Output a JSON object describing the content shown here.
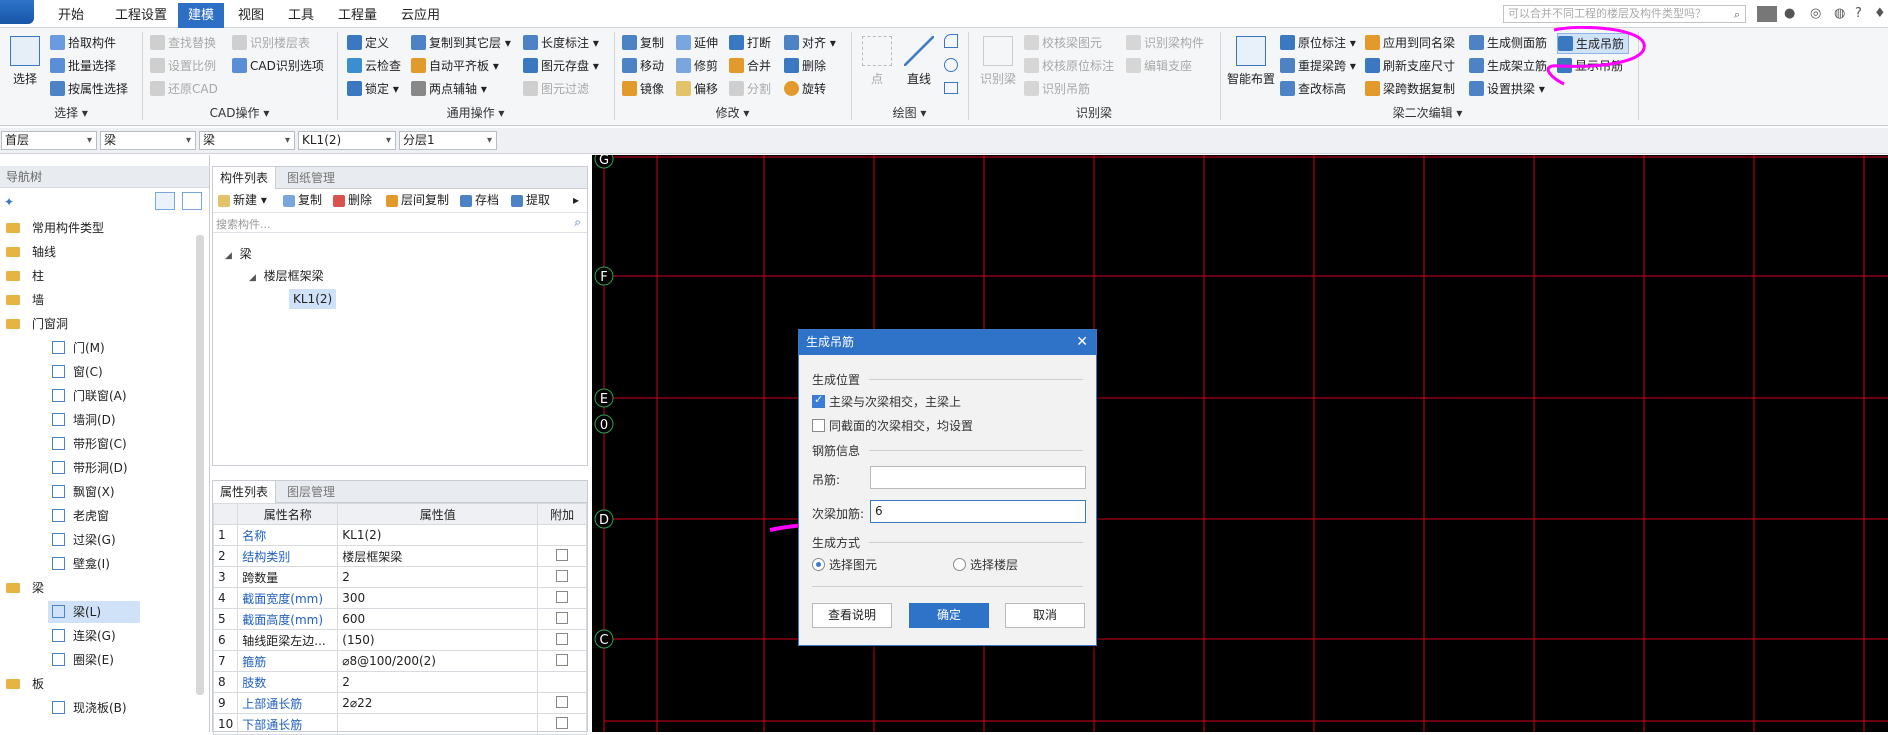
{
  "menubar": {
    "items": [
      "开始",
      "工程设置",
      "建模",
      "视图",
      "工具",
      "工程量",
      "云应用"
    ],
    "active_index": 2,
    "search_placeholder": "可以合并不同工程的楼层及构件类型吗？"
  },
  "ribbon": {
    "select_group": {
      "big_button": "选择",
      "buttons": [
        "拾取构件",
        "批量选择",
        "按属性选择"
      ],
      "label": "选择"
    },
    "cad_group": {
      "buttons": [
        "查找替换",
        "设置比例",
        "还原CAD",
        "识别楼层表",
        "CAD识别选项"
      ],
      "label": "CAD操作"
    },
    "general_group": {
      "buttons": [
        "定义",
        "云检查",
        "锁定",
        "复制到其它层",
        "自动平齐板",
        "两点辅轴",
        "长度标注",
        "图元存盘",
        "图元过滤"
      ],
      "label": "通用操作"
    },
    "modify_group": {
      "buttons": [
        "复制",
        "移动",
        "镜像",
        "延伸",
        "修剪",
        "偏移",
        "打断",
        "合并",
        "分割",
        "对齐",
        "删除",
        "旋转"
      ],
      "label": "修改"
    },
    "draw_group": {
      "buttons": [
        "点",
        "直线"
      ],
      "label": "绘图"
    },
    "recognize_group": {
      "buttons": [
        "识别梁",
        "校核梁图元",
        "校核原位标注",
        "识别吊筋",
        "识别梁构件",
        "编辑支座"
      ],
      "label": "识别梁"
    },
    "beam_edit_group": {
      "buttons": [
        "智能布置",
        "原位标注",
        "重提梁跨",
        "查改标高",
        "应用到同名梁",
        "刷新支座尺寸",
        "梁跨数据复制",
        "生成侧面筋",
        "生成架立筋",
        "设置拱梁",
        "生成吊筋",
        "显示吊筋"
      ],
      "label": "梁二次编辑"
    }
  },
  "selectors": [
    "首层",
    "梁",
    "梁",
    "KL1(2)",
    "分层1"
  ],
  "nav": {
    "title": "导航树",
    "items": [
      {
        "label": "常用构件类型",
        "type": "folder"
      },
      {
        "label": "轴线",
        "type": "folder"
      },
      {
        "label": "柱",
        "type": "folder"
      },
      {
        "label": "墙",
        "type": "folder"
      },
      {
        "label": "门窗洞",
        "type": "folder"
      },
      {
        "label": "门(M)",
        "type": "child"
      },
      {
        "label": "窗(C)",
        "type": "child"
      },
      {
        "label": "门联窗(A)",
        "type": "child"
      },
      {
        "label": "墙洞(D)",
        "type": "child"
      },
      {
        "label": "带形窗(C)",
        "type": "child"
      },
      {
        "label": "带形洞(D)",
        "type": "child"
      },
      {
        "label": "飘窗(X)",
        "type": "child"
      },
      {
        "label": "老虎窗",
        "type": "child"
      },
      {
        "label": "过梁(G)",
        "type": "child"
      },
      {
        "label": "壁龛(I)",
        "type": "child"
      },
      {
        "label": "梁",
        "type": "folder"
      },
      {
        "label": "梁(L)",
        "type": "child",
        "selected": true
      },
      {
        "label": "连梁(G)",
        "type": "child"
      },
      {
        "label": "圈梁(E)",
        "type": "child"
      },
      {
        "label": "板",
        "type": "folder"
      },
      {
        "label": "现浇板(B)",
        "type": "child"
      }
    ]
  },
  "component_list": {
    "tabs": [
      "构件列表",
      "图纸管理"
    ],
    "toolbar": [
      "新建",
      "复制",
      "删除",
      "层间复制",
      "存档",
      "提取"
    ],
    "search_placeholder": "搜索构件...",
    "tree": {
      "root": "梁",
      "group": "楼层框架梁",
      "item": "KL1(2)"
    }
  },
  "property_list": {
    "tabs": [
      "属性列表",
      "图层管理"
    ],
    "headers": [
      "属性名称",
      "属性值",
      "附加"
    ],
    "rows": [
      {
        "n": "1",
        "name": "名称",
        "value": "KL1(2)",
        "blue": true,
        "check": false
      },
      {
        "n": "2",
        "name": "结构类别",
        "value": "楼层框架梁",
        "blue": true,
        "check": true
      },
      {
        "n": "3",
        "name": "跨数量",
        "value": "2",
        "blue": false,
        "check": true
      },
      {
        "n": "4",
        "name": "截面宽度(mm)",
        "value": "300",
        "blue": true,
        "check": true
      },
      {
        "n": "5",
        "name": "截面高度(mm)",
        "value": "600",
        "blue": true,
        "check": true
      },
      {
        "n": "6",
        "name": "轴线距梁左边...",
        "value": "(150)",
        "blue": false,
        "check": true
      },
      {
        "n": "7",
        "name": "箍筋",
        "value": "⌀8@100/200(2)",
        "blue": true,
        "check": true
      },
      {
        "n": "8",
        "name": "肢数",
        "value": "2",
        "blue": true,
        "check": false
      },
      {
        "n": "9",
        "name": "上部通长筋",
        "value": "2⌀22",
        "blue": true,
        "check": true
      },
      {
        "n": "10",
        "name": "下部通长筋",
        "value": "",
        "blue": true,
        "check": true
      }
    ]
  },
  "canvas": {
    "axis_labels": [
      "G",
      "F",
      "E",
      "0",
      "D",
      "C"
    ]
  },
  "dialog": {
    "title": "生成吊筋",
    "section_position": "生成位置",
    "option_main_secondary": "主梁与次梁相交，主梁上",
    "option_same_section": "同截面的次梁相交，均设置",
    "section_rebar": "钢筋信息",
    "hanger_label": "吊筋:",
    "hanger_value": "",
    "secondary_label": "次梁加筋:",
    "secondary_value": "6",
    "section_method": "生成方式",
    "method_element": "选择图元",
    "method_floor": "选择楼层",
    "btn_help": "查看说明",
    "btn_ok": "确定",
    "btn_cancel": "取消"
  },
  "colors": {
    "accent": "#2f73c8",
    "canvas_bg": "#000000",
    "grid_line": "#d0001a",
    "annotation": "#ff00ff"
  }
}
